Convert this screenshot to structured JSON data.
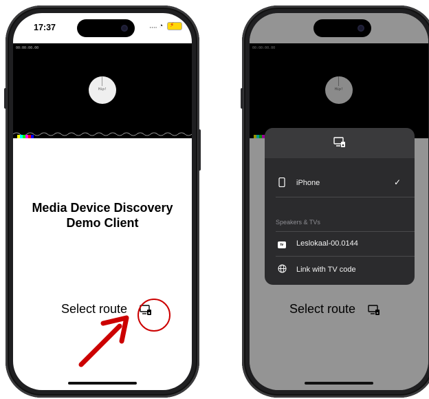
{
  "left_phone": {
    "status_time": "17:37",
    "status_dots": "....",
    "video": {
      "timecode": "00:00:00.00",
      "disc_label": "Hip!"
    },
    "app_title_line1": "Media Device Discovery",
    "app_title_line2": "Demo Client",
    "route_label": "Select route"
  },
  "right_phone": {
    "video": {
      "timecode": "00:00:00.00",
      "disc_label": "Hip!"
    },
    "route_label": "Select route",
    "route_popup": {
      "header_icon": "airplay-screen-icon",
      "current_device": {
        "name": "iPhone",
        "icon": "iphone-icon",
        "checkmark": "✓"
      },
      "section_title": "Speakers & TVs",
      "devices": [
        {
          "name": "Leslokaal-00.0144",
          "icon": "apple-tv-icon",
          "badge": "tv"
        },
        {
          "name": "Link with TV code",
          "icon": "globe-icon"
        }
      ]
    }
  },
  "annotation": {
    "highlight_color": "#cc0000"
  },
  "colors": {
    "popup_bg": "#2b2b2d",
    "popup_header": "#3a3a3c",
    "battery": "#ffd60a"
  }
}
